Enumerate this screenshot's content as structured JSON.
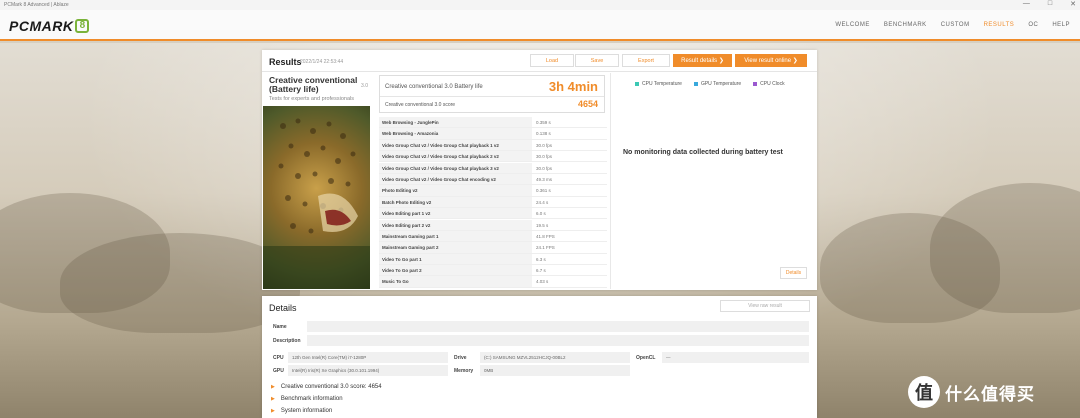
{
  "window": {
    "title": "PCMark 8 Advanced | Ablaze",
    "controls": [
      "—",
      "□",
      "✕"
    ]
  },
  "logo": {
    "word": "PCMARK",
    "num": "8"
  },
  "nav": [
    {
      "label": "WELCOME",
      "active": false
    },
    {
      "label": "BENCHMARK",
      "active": false
    },
    {
      "label": "CUSTOM",
      "active": false
    },
    {
      "label": "RESULTS",
      "active": true
    },
    {
      "label": "OC",
      "active": false
    },
    {
      "label": "HELP",
      "active": false
    }
  ],
  "results": {
    "title": "Results",
    "date": "2022/1/24 22:53:44",
    "buttons": {
      "load": "Load",
      "save": "Save",
      "export": "Export",
      "details": "Result details ❯",
      "online": "View result online ❯"
    },
    "test_name": "Creative conventional (Battery life)",
    "test_version": "3.0",
    "test_sub": "Tests for experts and professionals",
    "score_label": "Creative conventional 3.0 Battery life",
    "battery_time": "3h 4min",
    "score_name": "Creative conventional 3.0 score",
    "score": "4654",
    "rows": [
      {
        "name": "Web Browsing - JunglePin",
        "value": "0.359 s"
      },
      {
        "name": "Web Browsing - Amazonia",
        "value": "0.138 s"
      },
      {
        "name": "Video Group Chat v2 / Video Group Chat playback 1 v2",
        "value": "30.0 fps"
      },
      {
        "name": "Video Group Chat v2 / Video Group Chat playback 2 v2",
        "value": "30.0 fps"
      },
      {
        "name": "Video Group Chat v2 / Video Group Chat playback 3 v2",
        "value": "30.0 fps"
      },
      {
        "name": "Video Group Chat v2 / Video Group Chat encoding v2",
        "value": "49.3 ms"
      },
      {
        "name": "Photo Editing v2",
        "value": "0.361 s"
      },
      {
        "name": "Batch Photo Editing v2",
        "value": "24.4 s"
      },
      {
        "name": "Video Editing part 1 v2",
        "value": "6.0 s"
      },
      {
        "name": "Video Editing part 2 v2",
        "value": "19.5 s"
      },
      {
        "name": "Mainstream Gaming part 1",
        "value": "41.8 FPS"
      },
      {
        "name": "Mainstream Gaming part 2",
        "value": "24.1 FPS"
      },
      {
        "name": "Video To Go part 1",
        "value": "6.3 s"
      },
      {
        "name": "Video To Go part 2",
        "value": "6.7 s"
      },
      {
        "name": "Music To Go",
        "value": "4.03 s"
      }
    ],
    "legend": [
      {
        "label": "CPU Temperature",
        "color": "#3cc8b4"
      },
      {
        "label": "GPU Temperature",
        "color": "#39a9dc"
      },
      {
        "label": "CPU Clock",
        "color": "#9b59d0"
      }
    ],
    "nodata": "No monitoring data collected during battery test",
    "details_button": "Details"
  },
  "details": {
    "title": "Details",
    "view_raw": "View raw result",
    "name_label": "Name",
    "desc_label": "Description",
    "cpu_label": "CPU",
    "cpu_value": "12th Gen Intel(R) Core(TM) i7-1280P",
    "gpu_label": "GPU",
    "gpu_value": "Intel(R) Iris(R) Xe Graphics (30.0.101.1994)",
    "drive_label": "Drive",
    "drive_value": "(C:) SAMSUNG MZVL2512HCJQ-00BL2",
    "memory_label": "Memory",
    "memory_value": "0MB",
    "opencl_label": "OpenCL",
    "opencl_value": "—",
    "sections": [
      "Creative conventional 3.0 score: 4654",
      "Benchmark information",
      "System information"
    ]
  },
  "watermark": {
    "badge": "值",
    "text": "什么值得买"
  }
}
